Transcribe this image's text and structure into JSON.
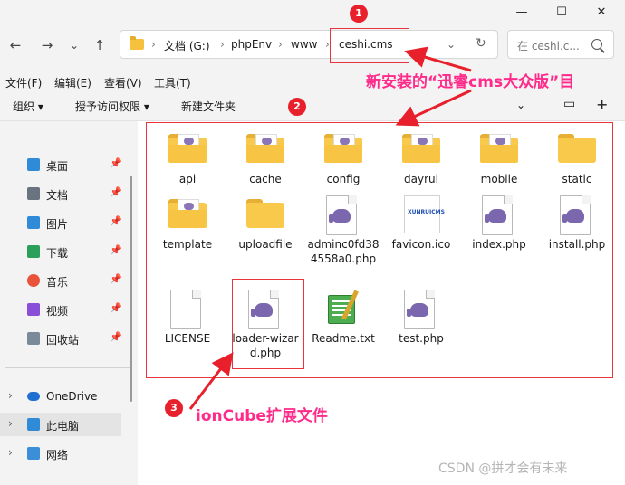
{
  "nav": {
    "crumbs": [
      "文档 (G:)",
      "phpEnv",
      "www",
      "ceshi.cms"
    ],
    "search_placeholder": "在 ceshi.c...",
    "controls": {
      "minimize": "—",
      "maximize": "☐",
      "close": "✕",
      "back": "←",
      "forward": "→",
      "recent": "⌄",
      "up": "↑",
      "dropdown": "⌄",
      "refresh": "↻",
      "separator": "›"
    }
  },
  "menu": [
    "文件(F)",
    "编辑(E)",
    "查看(V)",
    "工具(T)"
  ],
  "toolbar": {
    "organize": "组织 ▾",
    "grant": "授予访问权限 ▾",
    "new_folder": "新建文件夹",
    "view": "⌄",
    "pane": "▭",
    "add": "+"
  },
  "sidebar": {
    "quick": [
      {
        "label": "桌面",
        "icon": "desktop-icon",
        "color": "#2f8ad8"
      },
      {
        "label": "文档",
        "icon": "document-icon",
        "color": "#6a7480"
      },
      {
        "label": "图片",
        "icon": "pictures-icon",
        "color": "#2f8ad8"
      },
      {
        "label": "下载",
        "icon": "download-icon",
        "color": "#2aa05a"
      },
      {
        "label": "音乐",
        "icon": "music-icon",
        "color": "#e8533a"
      },
      {
        "label": "视频",
        "icon": "video-icon",
        "color": "#8a4fd8"
      },
      {
        "label": "回收站",
        "icon": "recycle-bin-icon",
        "color": "#7a8a99"
      }
    ],
    "tree": [
      {
        "label": "OneDrive",
        "icon": "onedrive-icon",
        "color": "#1f6fd1"
      },
      {
        "label": "此电脑",
        "icon": "this-pc-icon",
        "color": "#2f8ad8"
      },
      {
        "label": "网络",
        "icon": "network-icon",
        "color": "#3b8fd8"
      }
    ],
    "pin": "📌",
    "chevron": "›"
  },
  "files": [
    {
      "name": "api",
      "type": "folder-php"
    },
    {
      "name": "cache",
      "type": "folder-php"
    },
    {
      "name": "config",
      "type": "folder-php"
    },
    {
      "name": "dayrui",
      "type": "folder-php"
    },
    {
      "name": "mobile",
      "type": "folder-php"
    },
    {
      "name": "static",
      "type": "folder"
    },
    {
      "name": "template",
      "type": "folder-php"
    },
    {
      "name": "uploadfile",
      "type": "folder"
    },
    {
      "name": "adminc0fd384558a0.php",
      "type": "php"
    },
    {
      "name": "favicon.ico",
      "type": "favicon"
    },
    {
      "name": "index.php",
      "type": "php"
    },
    {
      "name": "install.php",
      "type": "php"
    },
    {
      "name": "LICENSE",
      "type": "doc"
    },
    {
      "name": "loader-wizard.php",
      "type": "php"
    },
    {
      "name": "Readme.txt",
      "type": "notepad"
    },
    {
      "name": "test.php",
      "type": "php"
    }
  ],
  "favicon_text": "XUNRUICMS",
  "annotations": {
    "badge1": "1",
    "badge2": "2",
    "badge3": "3",
    "note1": "新安装的“迅睿cms大众版”目",
    "note3": "ionCube扩展文件"
  },
  "watermark": "CSDN @拼才会有未来",
  "colors": {
    "annotation_red": "#e8343c",
    "annotation_pink": "#ff2a8a",
    "folder": "#f8c94a",
    "php": "#7b67ae"
  }
}
